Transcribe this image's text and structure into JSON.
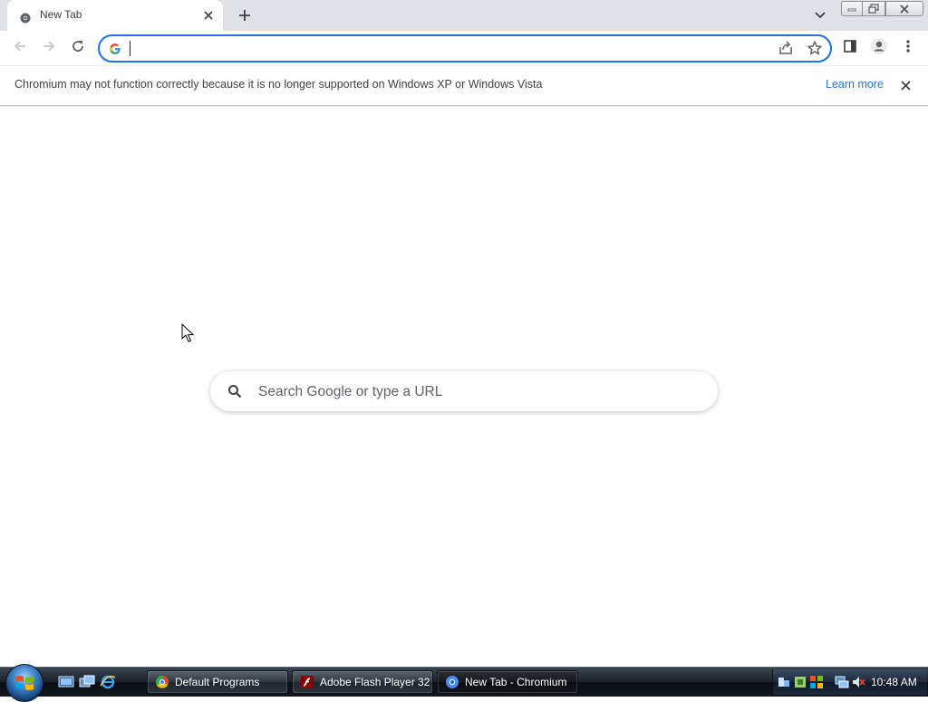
{
  "tabstrip": {
    "tab_title": "New Tab",
    "icons": [
      "chromium-favicon",
      "close-icon",
      "plus-icon",
      "chevron-down-icon"
    ],
    "window_buttons": [
      "minimize",
      "maximize",
      "close"
    ]
  },
  "toolbar": {
    "omnibox_value": "",
    "icons": [
      "back-arrow-icon",
      "forward-arrow-icon",
      "reload-icon",
      "google-g-icon",
      "share-icon",
      "star-icon",
      "side-panel-icon",
      "profile-icon",
      "menu-icon"
    ]
  },
  "infobar": {
    "message": "Chromium may not function correctly because it is no longer supported on Windows XP or Windows Vista",
    "link": "Learn more"
  },
  "ntp": {
    "search_placeholder": "Search Google or type a URL"
  },
  "taskbar": {
    "buttons": [
      {
        "label": "Default Programs",
        "icon": "default-programs-icon"
      },
      {
        "label": "Adobe Flash Player 32",
        "icon": "flash-icon"
      },
      {
        "label": "New Tab - Chromium",
        "icon": "chromium-icon",
        "active": true
      }
    ],
    "quick_launch": [
      "show-desktop-icon",
      "switch-windows-icon",
      "internet-explorer-icon"
    ],
    "clock": "10:48 AM"
  },
  "colors": {
    "accent": "#1a73e8",
    "tabstrip_bg": "#dee1e6",
    "link": "#1a73e8"
  }
}
